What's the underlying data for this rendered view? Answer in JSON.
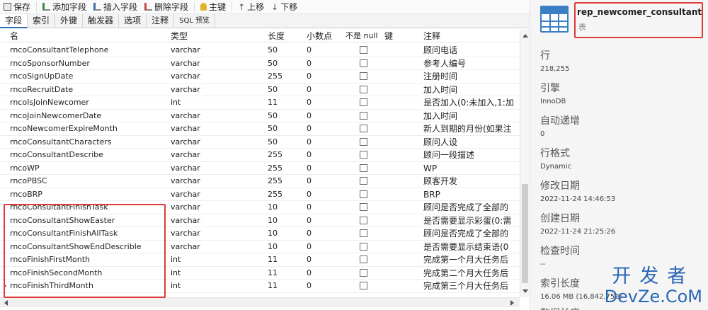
{
  "toolbar": {
    "save": "保存",
    "add_field": "添加字段",
    "insert_field": "插入字段",
    "delete_field": "删除字段",
    "primary_key": "主键",
    "move_up": "上移",
    "move_down": "下移"
  },
  "tabs": [
    "字段",
    "索引",
    "外键",
    "触发器",
    "选项",
    "注释",
    "SQL 预览"
  ],
  "columns": {
    "name": "名",
    "type": "类型",
    "length": "长度",
    "decimal": "小数点",
    "not_null": "不是 null",
    "key": "键",
    "comment": "注释"
  },
  "rows": [
    {
      "name": "rncoConsultantTelephone",
      "type": "varchar",
      "length": "50",
      "decimal": "0",
      "comment": "顾问电话"
    },
    {
      "name": "rncoSponsorNumber",
      "type": "varchar",
      "length": "50",
      "decimal": "0",
      "comment": "参考人编号"
    },
    {
      "name": "rncoSignUpDate",
      "type": "varchar",
      "length": "255",
      "decimal": "0",
      "comment": "注册时间"
    },
    {
      "name": "rncoRecruitDate",
      "type": "varchar",
      "length": "50",
      "decimal": "0",
      "comment": "加入时间"
    },
    {
      "name": "rncoIsJoinNewcomer",
      "type": "int",
      "length": "11",
      "decimal": "0",
      "comment": "是否加入(0:未加入,1:加"
    },
    {
      "name": "rncoJoinNewcomerDate",
      "type": "varchar",
      "length": "50",
      "decimal": "0",
      "comment": "加入时间"
    },
    {
      "name": "rncoNewcomerExpireMonth",
      "type": "varchar",
      "length": "50",
      "decimal": "0",
      "comment": "新人到期的月份(如果注"
    },
    {
      "name": "rncoConsultantCharacters",
      "type": "varchar",
      "length": "50",
      "decimal": "0",
      "comment": "顾问人设"
    },
    {
      "name": "rncoConsultantDescribe",
      "type": "varchar",
      "length": "255",
      "decimal": "0",
      "comment": "顾问一段描述"
    },
    {
      "name": "rncoWP",
      "type": "varchar",
      "length": "255",
      "decimal": "0",
      "comment": "WP"
    },
    {
      "name": "rncoPBSC",
      "type": "varchar",
      "length": "255",
      "decimal": "0",
      "comment": "顾客开发"
    },
    {
      "name": "rncoBRP",
      "type": "varchar",
      "length": "255",
      "decimal": "0",
      "comment": "BRP"
    },
    {
      "name": "rncoConsultantFinishTask",
      "type": "varchar",
      "length": "10",
      "decimal": "0",
      "comment": "顾问是否完成了全部的"
    },
    {
      "name": "rncoConsultantShowEaster",
      "type": "varchar",
      "length": "10",
      "decimal": "0",
      "comment": "是否需要显示彩蛋(0:需"
    },
    {
      "name": "rncoConsultantFinishAllTask",
      "type": "varchar",
      "length": "10",
      "decimal": "0",
      "comment": "顾问是否完成了全部的"
    },
    {
      "name": "rncoConsultantShowEndDescrible",
      "type": "varchar",
      "length": "10",
      "decimal": "0",
      "comment": "是否需要显示结束语(0"
    },
    {
      "name": "rncoFinishFirstMonth",
      "type": "int",
      "length": "11",
      "decimal": "0",
      "comment": "完成第一个月大任务后"
    },
    {
      "name": "rncoFinishSecondMonth",
      "type": "int",
      "length": "11",
      "decimal": "0",
      "comment": "完成第二个月大任务后"
    },
    {
      "name": "rncoFinishThirdMonth",
      "type": "int",
      "length": "11",
      "decimal": "0",
      "comment": "完成第三个月大任务后"
    }
  ],
  "object": {
    "name": "rep_newcomer_consultant",
    "kind": "表"
  },
  "properties": [
    {
      "label": "行",
      "value": "218,255"
    },
    {
      "label": "引擎",
      "value": "InnoDB"
    },
    {
      "label": "自动递增",
      "value": "0"
    },
    {
      "label": "行格式",
      "value": "Dynamic"
    },
    {
      "label": "修改日期",
      "value": "2022-11-24 14:46:53"
    },
    {
      "label": "创建日期",
      "value": "2022-11-24 21:25:26"
    },
    {
      "label": "检查时间",
      "value": "--"
    },
    {
      "label": "索引长度",
      "value": "16.06 MB (16,842,752)"
    },
    {
      "label": "数据长度",
      "value": ""
    }
  ],
  "watermark": {
    "line1": "开发者",
    "line2": "DevZe.CoM"
  },
  "colors": {
    "accent": "#3a7fc4",
    "highlight": "#e03b3b",
    "watermark": "#2a66b8"
  }
}
